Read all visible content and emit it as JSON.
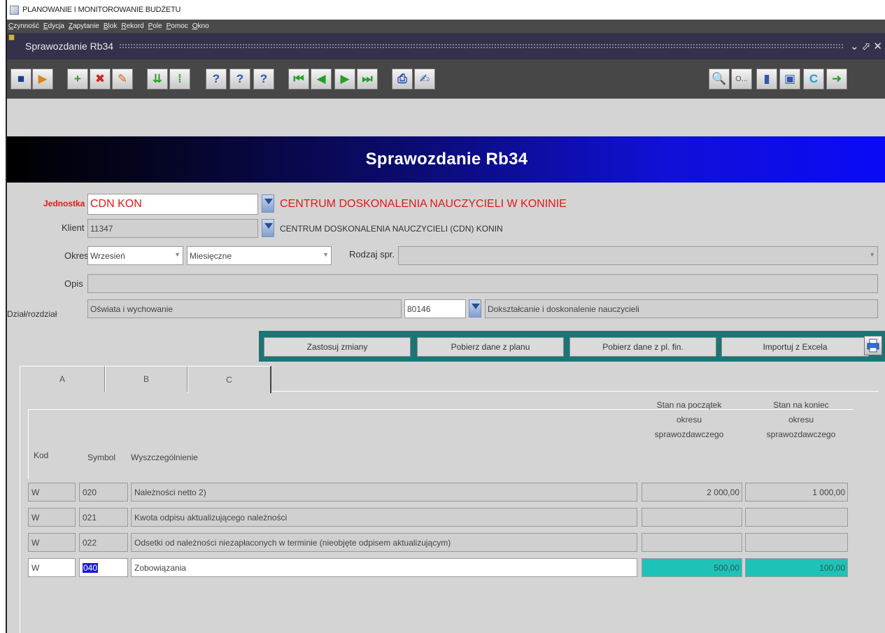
{
  "titlebar": {
    "title": "PLANOWANIE I MONITOROWANIE BUDŻETU"
  },
  "menu": [
    "Czynność",
    "Edycja",
    "Zapytanie",
    "Blok",
    "Rekord",
    "Pole",
    "Pomoc",
    "Okno"
  ],
  "window": {
    "title": "Sprawozdanie Rb34",
    "controls": "⌄ ⬀ ✕"
  },
  "toolbar": {
    "buttons": [
      {
        "name": "save-icon",
        "glyph": "■",
        "color": "#1b3f8a"
      },
      {
        "name": "exit-form-icon",
        "glyph": "▶",
        "color": "#d8871b"
      },
      {
        "name": "insert-record-icon",
        "glyph": "+",
        "color": "#23a023"
      },
      {
        "name": "delete-record-icon",
        "glyph": "✖",
        "color": "#d42020"
      },
      {
        "name": "clear-record-icon",
        "glyph": "✎",
        "color": "#d46a1b"
      },
      {
        "name": "duplicate-record-icon",
        "glyph": "⇊",
        "color": "#23a023"
      },
      {
        "name": "clear-block-icon",
        "glyph": "⁞",
        "color": "#23a023"
      },
      {
        "name": "enter-query-icon",
        "glyph": "?",
        "color": "#2f56b5"
      },
      {
        "name": "execute-query-icon",
        "glyph": "?",
        "color": "#2f56b5"
      },
      {
        "name": "count-query-icon",
        "glyph": "?",
        "color": "#2f56b5"
      },
      {
        "name": "first-record-icon",
        "glyph": "⏮",
        "color": "#23a023"
      },
      {
        "name": "previous-record-icon",
        "glyph": "◀",
        "color": "#23a023"
      },
      {
        "name": "next-record-icon",
        "glyph": "▶",
        "color": "#23a023"
      },
      {
        "name": "last-record-icon",
        "glyph": "⏭",
        "color": "#23a023"
      },
      {
        "name": "print-icon",
        "glyph": "⎙",
        "color": "#2f56b5"
      },
      {
        "name": "edit-icon",
        "glyph": "✍",
        "color": "#2f56b5"
      }
    ],
    "right_buttons": [
      {
        "name": "preview-icon",
        "glyph": "🔍",
        "color": "#2f56b5"
      },
      {
        "name": "options-button",
        "glyph": "O...",
        "color": "#555555"
      },
      {
        "name": "document-icon",
        "glyph": "▮",
        "color": "#2f56b5"
      },
      {
        "name": "windows-icon",
        "glyph": "▣",
        "color": "#2f56b5"
      },
      {
        "name": "calculator-icon",
        "glyph": "C",
        "color": "#1b9fd6"
      },
      {
        "name": "exit-icon",
        "glyph": "➜",
        "color": "#23a023"
      }
    ]
  },
  "banner": {
    "title": "Sprawozdanie Rb34"
  },
  "form": {
    "jednostka": {
      "label": "Jednostka",
      "value": "CDN KON",
      "description": "CENTRUM DOSKONALENIA NAUCZYCIELI W KONINIE"
    },
    "klient": {
      "label": "Klient",
      "value": "11347",
      "description": "CENTRUM DOSKONALENIA NAUCZYCIELI (CDN) KONIN"
    },
    "okres": {
      "label": "Okres",
      "month": "Wrzesień",
      "period": "Miesięczne"
    },
    "rodzaj": {
      "label": "Rodzaj spr.",
      "value": ""
    },
    "opis": {
      "label": "Opis",
      "value": ""
    },
    "dzial": {
      "label": "Dział/rozdział",
      "value": "Oświata i wychowanie",
      "code": "80146",
      "description": "Dokształcanie i doskonalenie nauczycieli"
    }
  },
  "actions": {
    "apply": "Zastosuj zmiany",
    "from_plan": "Pobierz dane z planu",
    "from_fin_plan": "Pobierz dane z pl. fin.",
    "import_excel": "Importuj z Excela"
  },
  "tabs": [
    "A",
    "B",
    "C"
  ],
  "table": {
    "headers": {
      "kod": "Kod",
      "symbol": "Symbol",
      "opis": "Wyszczególnienie",
      "start_1": "Stan na początek",
      "start_2": "okresu",
      "start_3": "sprawozdawczego",
      "end_1": "Stan na koniec",
      "end_2": "okresu",
      "end_3": "sprawozdawczego"
    },
    "rows": [
      {
        "kod": "W",
        "symbol": "020",
        "opis": "Należności netto 2)",
        "start": "2 000,00",
        "end": "1 000,00"
      },
      {
        "kod": "W",
        "symbol": "021",
        "opis": "Kwota odpisu aktualizującego należności",
        "start": "",
        "end": ""
      },
      {
        "kod": "W",
        "symbol": "022",
        "opis": "Odsetki od należności niezapłaconych w terminie (nieobjęte odpisem aktualizującym)",
        "start": "",
        "end": ""
      },
      {
        "kod": "W",
        "symbol": "040",
        "opis": "Zobowiązania",
        "start": "500,00",
        "end": "100,00"
      }
    ]
  },
  "colors": {
    "required_label": "#e01919",
    "banner_blue": "#0a0af6",
    "action_bar": "#1a7575",
    "active_row_values": "#1fc2b6"
  }
}
